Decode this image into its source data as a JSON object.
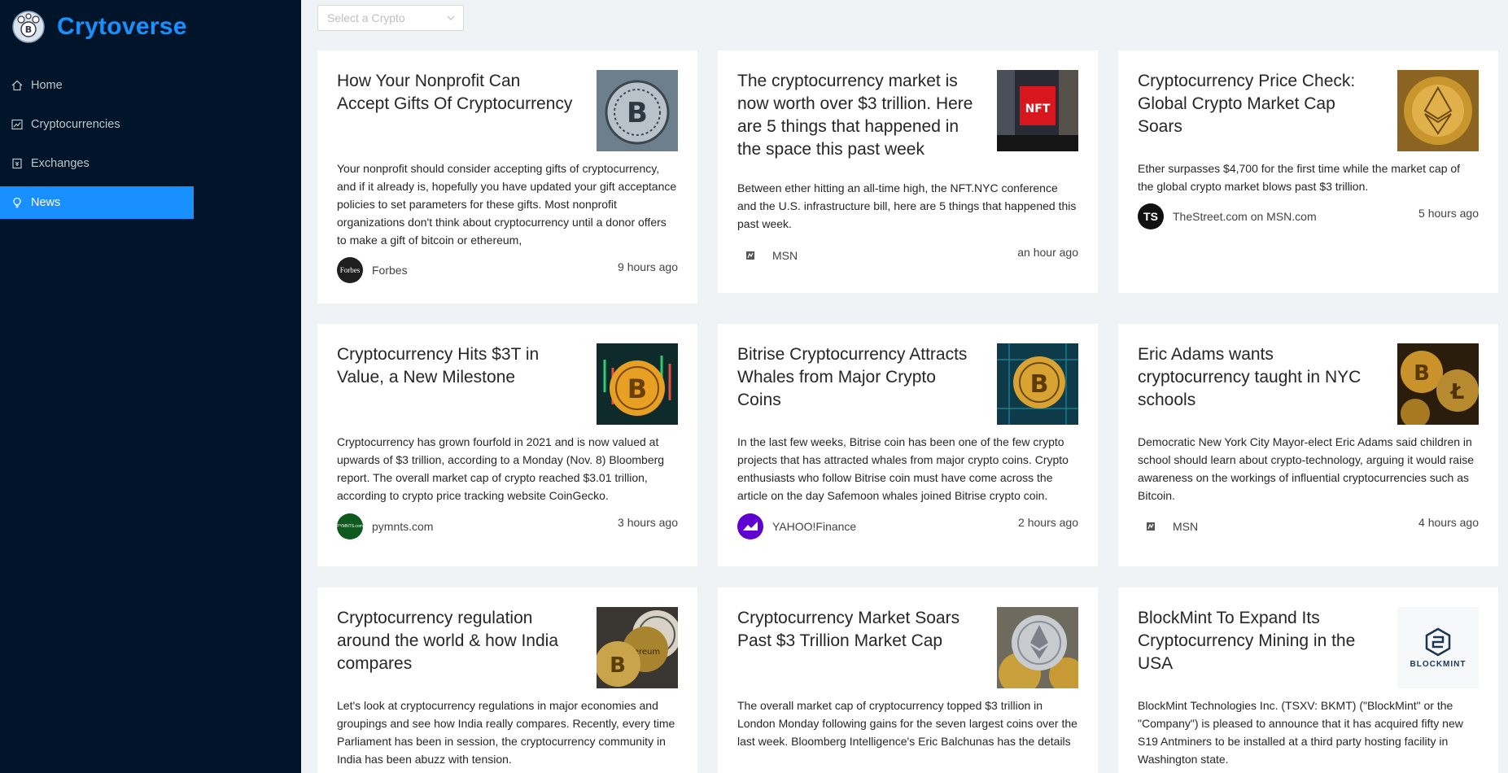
{
  "app": {
    "title": "Crytoverse"
  },
  "nav": [
    {
      "label": "Home",
      "icon": "home-icon"
    },
    {
      "label": "Cryptocurrencies",
      "icon": "fund-icon"
    },
    {
      "label": "Exchanges",
      "icon": "money-collect-icon"
    },
    {
      "label": "News",
      "icon": "bulb-icon",
      "active": true
    }
  ],
  "select": {
    "placeholder": "Select a Crypto"
  },
  "colors": {
    "sidebar": "#001529",
    "accent": "#1890ff",
    "background": "#f0f2f5"
  },
  "cards": [
    {
      "title": "How Your Nonprofit Can Accept Gifts Of Cryptocurrency",
      "description": "Your nonprofit should consider accepting gifts of cryptocurrency, and if it already is, hopefully you have updated your gift acceptance policies to set parameters for these gifts. Most nonprofit organizations don't think about cryptocurrency until a donor offers to make a gift of bitcoin or ethereum,",
      "provider": "Forbes",
      "provider_avatar": "Forbes",
      "time": "9 hours ago"
    },
    {
      "title": "The cryptocurrency market is now worth over $3 trillion. Here are 5 things that happened in the space this past week",
      "description": "Between ether hitting an all-time high, the NFT.NYC conference and the U.S. infrastructure bill, here are 5 things that happened this past week.",
      "provider": "MSN",
      "provider_avatar": "",
      "time": "an hour ago"
    },
    {
      "title": "Cryptocurrency Price Check: Global Crypto Market Cap Soars",
      "description": "Ether surpasses $4,700 for the first time while the market cap of the global crypto market blows past $3 trillion.",
      "provider": "TheStreet.com on MSN.com",
      "provider_avatar": "TS",
      "time": "5 hours ago"
    },
    {
      "title": "Cryptocurrency Hits $3T in Value, a New Milestone",
      "description": "Cryptocurrency has grown fourfold in 2021 and is now valued at upwards of $3 trillion, according to a Monday (Nov. 8) Bloomberg report. The overall market cap of crypto reached $3.01 trillion, according to crypto price tracking website CoinGecko.",
      "provider": "pymnts.com",
      "provider_avatar": "PYMNTS.com",
      "time": "3 hours ago"
    },
    {
      "title": "Bitrise Cryptocurrency Attracts Whales from Major Crypto Coins",
      "description": "In the last few weeks, Bitrise coin has been one of the few crypto projects that has attracted whales from major crypto coins. Crypto enthusiasts who follow Bitrise coin must have come across the article on the day Safemoon whales joined Bitrise crypto coin.",
      "provider": "YAHOO!Finance",
      "provider_avatar": "",
      "time": "2 hours ago"
    },
    {
      "title": "Eric Adams wants cryptocurrency taught in NYC schools",
      "description": "Democratic New York City Mayor-elect Eric Adams said children in school should learn about crypto-technology, arguing it would raise awareness on the workings of influential cryptocurrencies such as Bitcoin.",
      "provider": "MSN",
      "provider_avatar": "",
      "time": "4 hours ago"
    },
    {
      "title": "Cryptocurrency regulation around the world & how India compares",
      "description": "Let's look at cryptocurrency regulations in major economies and groupings and see how India really compares. Recently, every time Parliament has been in session, the cryptocurrency community in India has been abuzz with tension.",
      "provider": "",
      "provider_avatar": "",
      "time": ""
    },
    {
      "title": "Cryptocurrency Market Soars Past $3 Trillion Market Cap",
      "description": "The overall market cap of cryptocurrency topped $3 trillion in London Monday following gains for the seven largest coins over the last week. Bloomberg Intelligence's Eric Balchunas has the details",
      "provider": "",
      "provider_avatar": "",
      "time": ""
    },
    {
      "title": "BlockMint To Expand Its Cryptocurrency Mining in the USA",
      "description": "BlockMint Technologies Inc. (TSXV: BKMT) (\"BlockMint\" or the \"Company\") is pleased to announce that it has acquired fifty new S19 Antminers to be installed at a third party hosting facility in Washington state.",
      "provider": "",
      "provider_avatar": "",
      "time": "",
      "image_text": "BLOCKMINT"
    }
  ]
}
